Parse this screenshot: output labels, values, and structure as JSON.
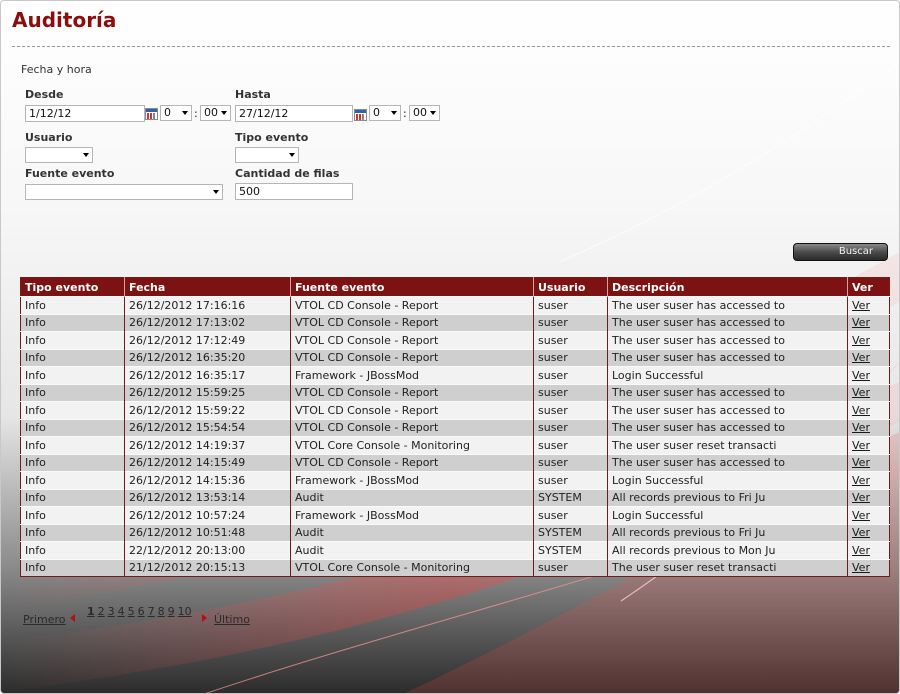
{
  "page": {
    "title": "Auditoría",
    "section_label": "Fecha y hora"
  },
  "filters": {
    "desde": {
      "label": "Desde",
      "date": "1/12/12",
      "hour": "0",
      "minute": "00"
    },
    "hasta": {
      "label": "Hasta",
      "date": "27/12/12",
      "hour": "0",
      "minute": "00"
    },
    "usuario": {
      "label": "Usuario",
      "value": ""
    },
    "tipo_evento": {
      "label": "Tipo evento",
      "value": ""
    },
    "fuente_evento": {
      "label": "Fuente evento",
      "value": ""
    },
    "cantidad_filas": {
      "label": "Cantidad de filas",
      "value": "500"
    },
    "time_separator": ":",
    "search_button": "Buscar"
  },
  "table": {
    "headers": [
      "Tipo evento",
      "Fecha",
      "Fuente evento",
      "Usuario",
      "Descripción",
      "Ver"
    ],
    "rows": [
      [
        "Info",
        "26/12/2012 17:16:16",
        "VTOL CD Console - Report",
        "suser",
        "The user suser has accessed to",
        "Ver"
      ],
      [
        "Info",
        "26/12/2012 17:13:02",
        "VTOL CD Console - Report",
        "suser",
        "The user suser has accessed to",
        "Ver"
      ],
      [
        "Info",
        "26/12/2012 17:12:49",
        "VTOL CD Console - Report",
        "suser",
        "The user suser has accessed to",
        "Ver"
      ],
      [
        "Info",
        "26/12/2012 16:35:20",
        "VTOL CD Console - Report",
        "suser",
        "The user suser has accessed to",
        "Ver"
      ],
      [
        "Info",
        "26/12/2012 16:35:17",
        "Framework - JBossMod",
        "suser",
        "Login Successful",
        "Ver"
      ],
      [
        "Info",
        "26/12/2012 15:59:25",
        "VTOL CD Console - Report",
        "suser",
        "The user suser has accessed to",
        "Ver"
      ],
      [
        "Info",
        "26/12/2012 15:59:22",
        "VTOL CD Console - Report",
        "suser",
        "The user suser has accessed to",
        "Ver"
      ],
      [
        "Info",
        "26/12/2012 15:54:54",
        "VTOL CD Console - Report",
        "suser",
        "The user suser has accessed to",
        "Ver"
      ],
      [
        "Info",
        "26/12/2012 14:19:37",
        "VTOL Core Console - Monitoring",
        "suser",
        "The user suser reset transacti",
        "Ver"
      ],
      [
        "Info",
        "26/12/2012 14:15:49",
        "VTOL CD Console - Report",
        "suser",
        "The user suser has accessed to",
        "Ver"
      ],
      [
        "Info",
        "26/12/2012 14:15:36",
        "Framework - JBossMod",
        "suser",
        "Login Successful",
        "Ver"
      ],
      [
        "Info",
        "26/12/2012 13:53:14",
        "Audit",
        "SYSTEM",
        "All records previous to Fri Ju",
        "Ver"
      ],
      [
        "Info",
        "26/12/2012 10:57:24",
        "Framework - JBossMod",
        "suser",
        "Login Successful",
        "Ver"
      ],
      [
        "Info",
        "26/12/2012 10:51:48",
        "Audit",
        "SYSTEM",
        "All records previous to Fri Ju",
        "Ver"
      ],
      [
        "Info",
        "22/12/2012 20:13:00",
        "Audit",
        "SYSTEM",
        "All records previous to Mon Ju",
        "Ver"
      ],
      [
        "Info",
        "21/12/2012 20:15:13",
        "VTOL Core Console - Monitoring",
        "suser",
        "The user suser reset transacti",
        "Ver"
      ]
    ]
  },
  "pagination": {
    "first": "Primero",
    "last": "Último",
    "pages": [
      "1",
      "2",
      "3",
      "4",
      "5",
      "6",
      "7",
      "8",
      "9",
      "10"
    ],
    "current": "1"
  }
}
